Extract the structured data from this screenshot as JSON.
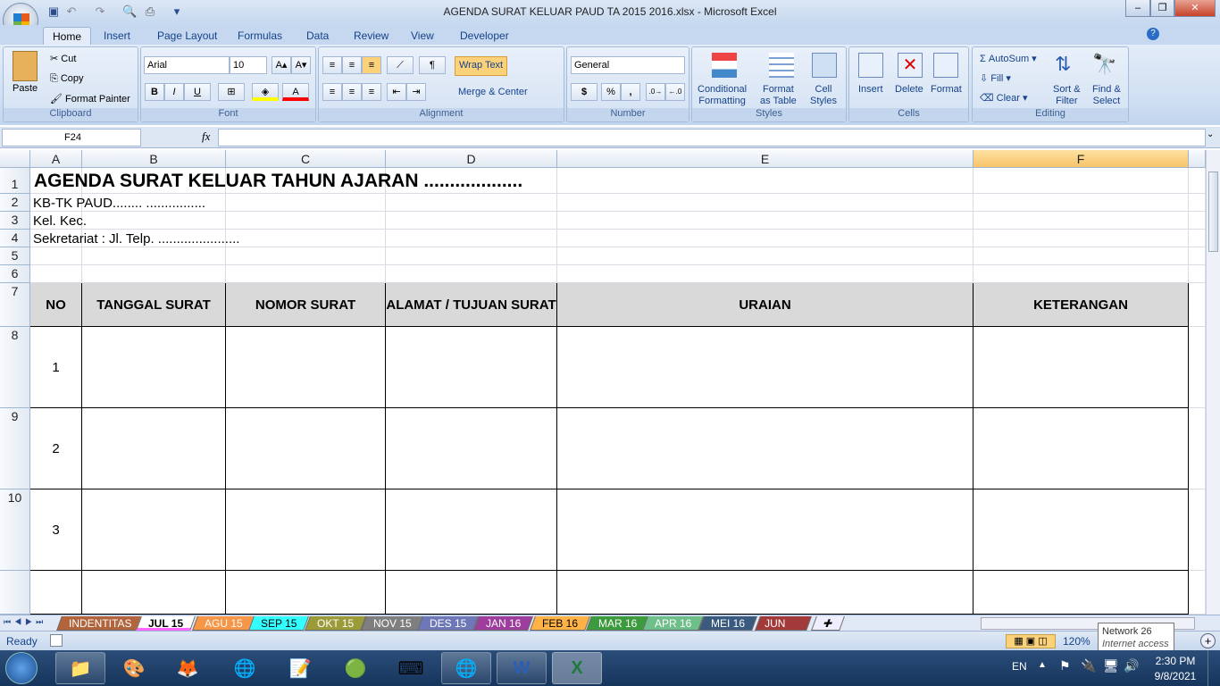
{
  "window": {
    "title": "AGENDA SURAT KELUAR PAUD TA 2015 2016.xlsx - Microsoft Excel",
    "minimize": "–",
    "restore": "❐",
    "close": "✕"
  },
  "ribbon_tabs": [
    "Home",
    "Insert",
    "Page Layout",
    "Formulas",
    "Data",
    "Review",
    "View",
    "Developer"
  ],
  "clipboard": {
    "paste": "Paste",
    "cut": "Cut",
    "copy": "Copy",
    "format_painter": "Format Painter",
    "label": "Clipboard"
  },
  "font": {
    "name": "Arial",
    "size": "10",
    "bold": "B",
    "italic": "I",
    "underline": "U",
    "label": "Font",
    "fill_color": "#ffff00",
    "font_color": "#ff0000"
  },
  "alignment": {
    "wrap_text": "Wrap Text",
    "merge_center": "Merge & Center",
    "label": "Alignment"
  },
  "number": {
    "format": "General",
    "currency": "$",
    "percent": "%",
    "comma": ",",
    "label": "Number"
  },
  "styles": {
    "conditional": "Conditional",
    "conditional2": "Formatting",
    "format_table": "Format",
    "format_table2": "as Table",
    "cell_styles": "Cell",
    "cell_styles2": "Styles",
    "label": "Styles"
  },
  "cells": {
    "insert": "Insert",
    "delete": "Delete",
    "format": "Format",
    "label": "Cells"
  },
  "editing": {
    "autosum": "AutoSum",
    "fill": "Fill",
    "clear": "Clear",
    "sort": "Sort &",
    "sort2": "Filter",
    "find": "Find &",
    "find2": "Select",
    "label": "Editing"
  },
  "formula_bar": {
    "name_box": "F24",
    "fx": "fx",
    "value": ""
  },
  "columns": [
    "A",
    "B",
    "C",
    "D",
    "E",
    "F"
  ],
  "rows": [
    "1",
    "2",
    "3",
    "4",
    "5",
    "6",
    "7",
    "8",
    "9",
    "10",
    ""
  ],
  "sheet": {
    "title": "AGENDA SURAT KELUAR TAHUN AJARAN ...................",
    "line2": "KB-TK PAUD........ ................",
    "line3": "Kel.  Kec.",
    "line4": "Sekretariat : Jl.  Telp. ......................",
    "headers": [
      "NO",
      "TANGGAL SURAT",
      "NOMOR SURAT",
      "ALAMAT / TUJUAN SURAT",
      "URAIAN",
      "KETERANGAN"
    ],
    "numbers": [
      "1",
      "2",
      "3"
    ]
  },
  "sheet_tabs": [
    {
      "name": "INDENTITAS",
      "color": "#b2643c"
    },
    {
      "name": "JUL 15",
      "color": "#ff66ff",
      "active": true
    },
    {
      "name": "AGU 15",
      "color": "#f79646"
    },
    {
      "name": "SEP 15",
      "color": "#33ffff"
    },
    {
      "name": "OKT 15",
      "color": "#9b9b3a"
    },
    {
      "name": "NOV 15",
      "color": "#7f7f7f"
    },
    {
      "name": "DES 15",
      "color": "#6e78b8"
    },
    {
      "name": "JAN 16",
      "color": "#9e3d9e"
    },
    {
      "name": "FEB 16",
      "color": "#ffb347"
    },
    {
      "name": "MAR 16",
      "color": "#3c9b3c"
    },
    {
      "name": "APR 16",
      "color": "#6fbf8a"
    },
    {
      "name": "MEI 16",
      "color": "#3a5a80"
    },
    {
      "name": "JUN 16",
      "color": "#a33a3a"
    }
  ],
  "status": {
    "ready": "Ready",
    "zoom": "120%"
  },
  "tooltip": {
    "line1": "Network  26",
    "line2": "Internet access"
  },
  "tray": {
    "lang": "EN",
    "time": "2:30 PM",
    "date": "9/8/2021"
  }
}
